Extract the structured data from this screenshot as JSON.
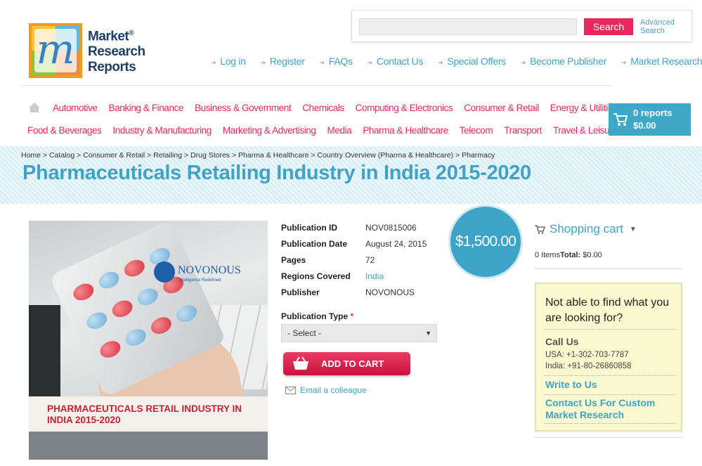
{
  "logo": {
    "line1": "Market",
    "line2": "Research",
    "line3": "Reports",
    "reg": "®"
  },
  "search": {
    "placeholder": "",
    "button": "Search",
    "advanced_line1": "Advanced",
    "advanced_line2": "Search"
  },
  "toplinks": [
    "Log in",
    "Register",
    "FAQs",
    "Contact Us",
    "Special Offers",
    "Become Publisher",
    "Market Research Blog"
  ],
  "nav_row1": [
    "Automotive",
    "Banking & Finance",
    "Business & Government",
    "Chemicals",
    "Computing & Electronics",
    "Consumer & Retail",
    "Energy & Utilities"
  ],
  "nav_row2": [
    "Food & Beverages",
    "Industry & Manufacturing",
    "Marketing & Advertising",
    "Media",
    "Pharma & Healthcare",
    "Telecom",
    "Transport",
    "Travel & Leisure"
  ],
  "cart_header": {
    "reports": "0 reports",
    "amount": "$0.00"
  },
  "breadcrumb": "Home > Catalog > Consumer & Retail > Retailing > Drug Stores > Pharma & Healthcare > Country Overview (Pharma & Healthcare) > Pharmacy",
  "title": "Pharmaceuticals Retailing Industry in India 2015-2020",
  "cover": {
    "brand": "NOVONOUS",
    "tagline": "Intelligence Redefined",
    "title_line1": "PHARMACEUTICALS RETAIL INDUSTRY IN",
    "title_line2": "INDIA 2015-2020"
  },
  "meta": [
    {
      "label": "Publication ID",
      "value": "NOV0815006"
    },
    {
      "label": "Publication Date",
      "value": "August 24, 2015"
    },
    {
      "label": "Pages",
      "value": "72"
    },
    {
      "label": "Regions Covered",
      "value": "India"
    },
    {
      "label": "Publisher",
      "value": "NOVONOUS"
    }
  ],
  "publication_type": {
    "label": "Publication Type",
    "required": "*",
    "selected": "- Select -"
  },
  "add_to_cart": "ADD TO CART",
  "email_colleague": "Email a colleague",
  "price": "$1,500.00",
  "shopping_cart": {
    "title": "Shopping cart",
    "items": "0 Items",
    "total_label": "Total:",
    "total": "$0.00"
  },
  "help": {
    "question": "Not able to find what you are looking for?",
    "call_us": "Call Us",
    "usa": "USA: +1-302-703-7787",
    "india": "India: +91-80-26860858",
    "write_to_us": "Write to Us",
    "contact_custom": "Contact Us For Custom Market Research"
  },
  "colors": {
    "accent_blue": "#3ea4c7",
    "accent_pink": "#e8285a",
    "logo_orange": "#f59a1e",
    "help_bg": "#fbf9cf"
  }
}
